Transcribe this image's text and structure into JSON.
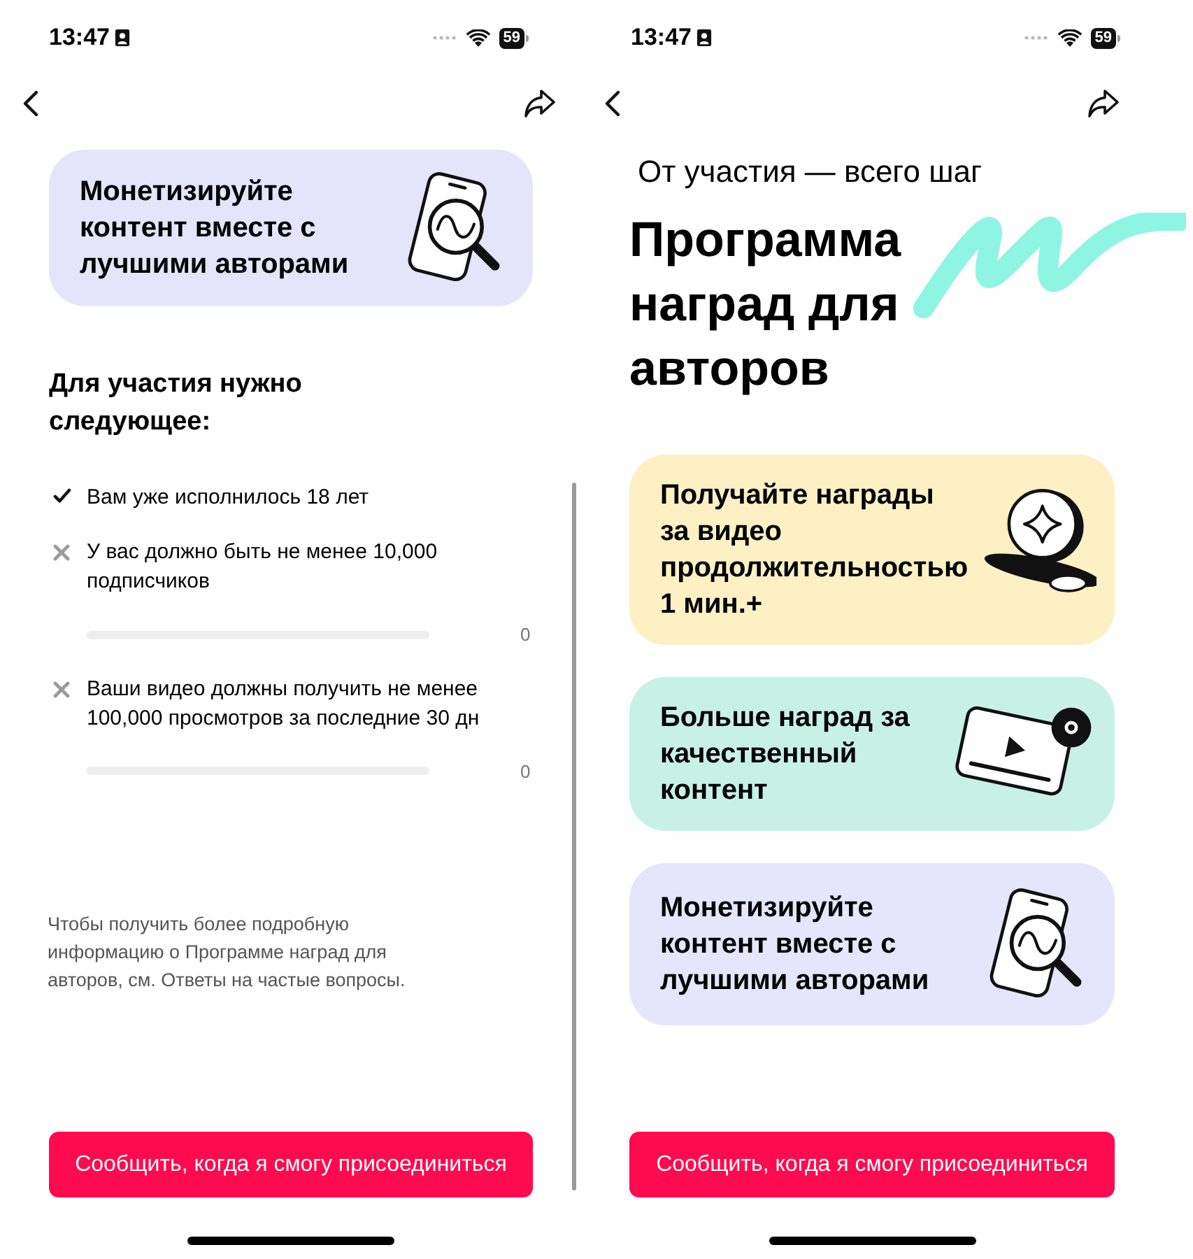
{
  "left_screen": {
    "status_bar": {
      "time": "13:47",
      "battery": "59"
    },
    "card": {
      "kind": "monetize",
      "title": "Монетизируйте\nконтент вместе с\nлучшими авторами"
    },
    "requirements_title": "Для участия нужно следующее:",
    "requirements": [
      {
        "text": "Вам уже исполнилось 18 лет",
        "met": true
      },
      {
        "text": "У вас должно быть не менее 10,000 подписчиков",
        "met": false,
        "level": 0,
        "reading": "0"
      },
      {
        "text": "Ваши видео должны получить не менее 100,000 просмотров за последние 30 дн",
        "met": false,
        "level": 0,
        "reading": "0"
      }
    ],
    "footnote": "Чтобы получить более подробную информацию о Программе наград для авторов, см. Ответы на частые вопросы.",
    "button": "Сообщить, когда я смогу присоединиться"
  },
  "right_screen": {
    "status_bar": {
      "time": "13:47",
      "battery": "59"
    },
    "subtitle": "От участия — всего шаг",
    "title": "Программа\nнаград для\nавторов",
    "cards": [
      {
        "kind": "coins",
        "title": "Получайте награды\nза видео\nпродолжительностью\n1 мин.+",
        "color": "#fdf0c4"
      },
      {
        "kind": "video",
        "title": "Больше наград за\nкачественный\nконтент",
        "color": "#c7f1e5"
      },
      {
        "kind": "monetize",
        "title": "Монетизируйте\nконтент вместе с\nлучшими авторами",
        "color": "#e5e5fb"
      }
    ],
    "button": "Сообщить, когда я смогу присоединиться"
  }
}
